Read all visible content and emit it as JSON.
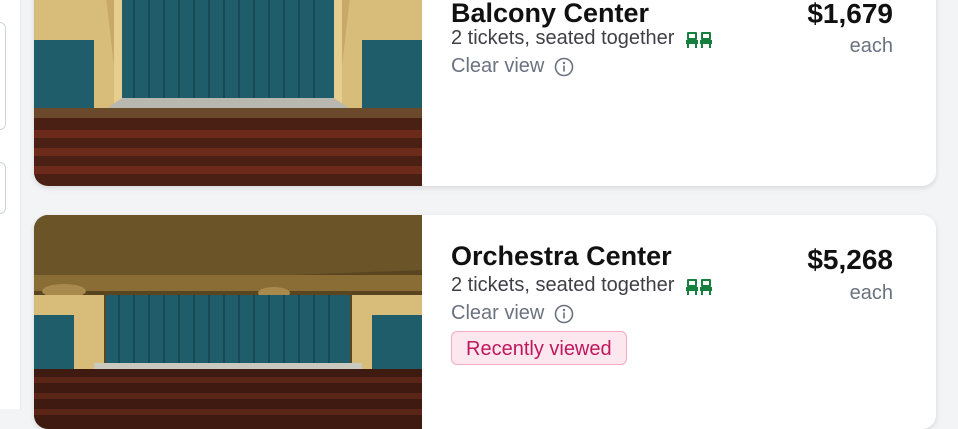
{
  "listings": [
    {
      "section": "Balcony Center",
      "tickets": "2 tickets, seated together",
      "view": "Clear view",
      "price": "$1,679",
      "price_unit": "each",
      "image": "balcony-stage-view"
    },
    {
      "section": "Orchestra Center",
      "tickets": "2 tickets, seated together",
      "view": "Clear view",
      "price": "$5,268",
      "price_unit": "each",
      "badge": "Recently viewed",
      "image": "orchestra-stage-view"
    }
  ],
  "colors": {
    "curtain": "#1f5d6b",
    "seats_icon": "#15803d",
    "badge_text": "#be185d",
    "badge_bg": "#fde7ef"
  },
  "icons": [
    "seats-together-icon",
    "info-icon"
  ]
}
